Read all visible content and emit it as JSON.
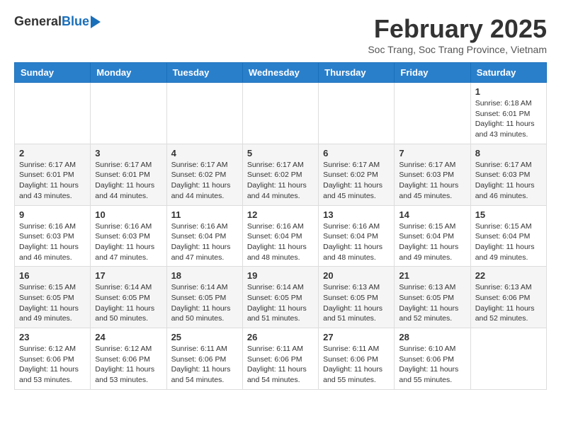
{
  "header": {
    "logo_general": "General",
    "logo_blue": "Blue",
    "month_title": "February 2025",
    "location": "Soc Trang, Soc Trang Province, Vietnam"
  },
  "weekdays": [
    "Sunday",
    "Monday",
    "Tuesday",
    "Wednesday",
    "Thursday",
    "Friday",
    "Saturday"
  ],
  "weeks": [
    [
      {
        "day": "",
        "info": ""
      },
      {
        "day": "",
        "info": ""
      },
      {
        "day": "",
        "info": ""
      },
      {
        "day": "",
        "info": ""
      },
      {
        "day": "",
        "info": ""
      },
      {
        "day": "",
        "info": ""
      },
      {
        "day": "1",
        "info": "Sunrise: 6:18 AM\nSunset: 6:01 PM\nDaylight: 11 hours and 43 minutes."
      }
    ],
    [
      {
        "day": "2",
        "info": "Sunrise: 6:17 AM\nSunset: 6:01 PM\nDaylight: 11 hours and 43 minutes."
      },
      {
        "day": "3",
        "info": "Sunrise: 6:17 AM\nSunset: 6:01 PM\nDaylight: 11 hours and 44 minutes."
      },
      {
        "day": "4",
        "info": "Sunrise: 6:17 AM\nSunset: 6:02 PM\nDaylight: 11 hours and 44 minutes."
      },
      {
        "day": "5",
        "info": "Sunrise: 6:17 AM\nSunset: 6:02 PM\nDaylight: 11 hours and 44 minutes."
      },
      {
        "day": "6",
        "info": "Sunrise: 6:17 AM\nSunset: 6:02 PM\nDaylight: 11 hours and 45 minutes."
      },
      {
        "day": "7",
        "info": "Sunrise: 6:17 AM\nSunset: 6:03 PM\nDaylight: 11 hours and 45 minutes."
      },
      {
        "day": "8",
        "info": "Sunrise: 6:17 AM\nSunset: 6:03 PM\nDaylight: 11 hours and 46 minutes."
      }
    ],
    [
      {
        "day": "9",
        "info": "Sunrise: 6:16 AM\nSunset: 6:03 PM\nDaylight: 11 hours and 46 minutes."
      },
      {
        "day": "10",
        "info": "Sunrise: 6:16 AM\nSunset: 6:03 PM\nDaylight: 11 hours and 47 minutes."
      },
      {
        "day": "11",
        "info": "Sunrise: 6:16 AM\nSunset: 6:04 PM\nDaylight: 11 hours and 47 minutes."
      },
      {
        "day": "12",
        "info": "Sunrise: 6:16 AM\nSunset: 6:04 PM\nDaylight: 11 hours and 48 minutes."
      },
      {
        "day": "13",
        "info": "Sunrise: 6:16 AM\nSunset: 6:04 PM\nDaylight: 11 hours and 48 minutes."
      },
      {
        "day": "14",
        "info": "Sunrise: 6:15 AM\nSunset: 6:04 PM\nDaylight: 11 hours and 49 minutes."
      },
      {
        "day": "15",
        "info": "Sunrise: 6:15 AM\nSunset: 6:04 PM\nDaylight: 11 hours and 49 minutes."
      }
    ],
    [
      {
        "day": "16",
        "info": "Sunrise: 6:15 AM\nSunset: 6:05 PM\nDaylight: 11 hours and 49 minutes."
      },
      {
        "day": "17",
        "info": "Sunrise: 6:14 AM\nSunset: 6:05 PM\nDaylight: 11 hours and 50 minutes."
      },
      {
        "day": "18",
        "info": "Sunrise: 6:14 AM\nSunset: 6:05 PM\nDaylight: 11 hours and 50 minutes."
      },
      {
        "day": "19",
        "info": "Sunrise: 6:14 AM\nSunset: 6:05 PM\nDaylight: 11 hours and 51 minutes."
      },
      {
        "day": "20",
        "info": "Sunrise: 6:13 AM\nSunset: 6:05 PM\nDaylight: 11 hours and 51 minutes."
      },
      {
        "day": "21",
        "info": "Sunrise: 6:13 AM\nSunset: 6:05 PM\nDaylight: 11 hours and 52 minutes."
      },
      {
        "day": "22",
        "info": "Sunrise: 6:13 AM\nSunset: 6:06 PM\nDaylight: 11 hours and 52 minutes."
      }
    ],
    [
      {
        "day": "23",
        "info": "Sunrise: 6:12 AM\nSunset: 6:06 PM\nDaylight: 11 hours and 53 minutes."
      },
      {
        "day": "24",
        "info": "Sunrise: 6:12 AM\nSunset: 6:06 PM\nDaylight: 11 hours and 53 minutes."
      },
      {
        "day": "25",
        "info": "Sunrise: 6:11 AM\nSunset: 6:06 PM\nDaylight: 11 hours and 54 minutes."
      },
      {
        "day": "26",
        "info": "Sunrise: 6:11 AM\nSunset: 6:06 PM\nDaylight: 11 hours and 54 minutes."
      },
      {
        "day": "27",
        "info": "Sunrise: 6:11 AM\nSunset: 6:06 PM\nDaylight: 11 hours and 55 minutes."
      },
      {
        "day": "28",
        "info": "Sunrise: 6:10 AM\nSunset: 6:06 PM\nDaylight: 11 hours and 55 minutes."
      },
      {
        "day": "",
        "info": ""
      }
    ]
  ]
}
